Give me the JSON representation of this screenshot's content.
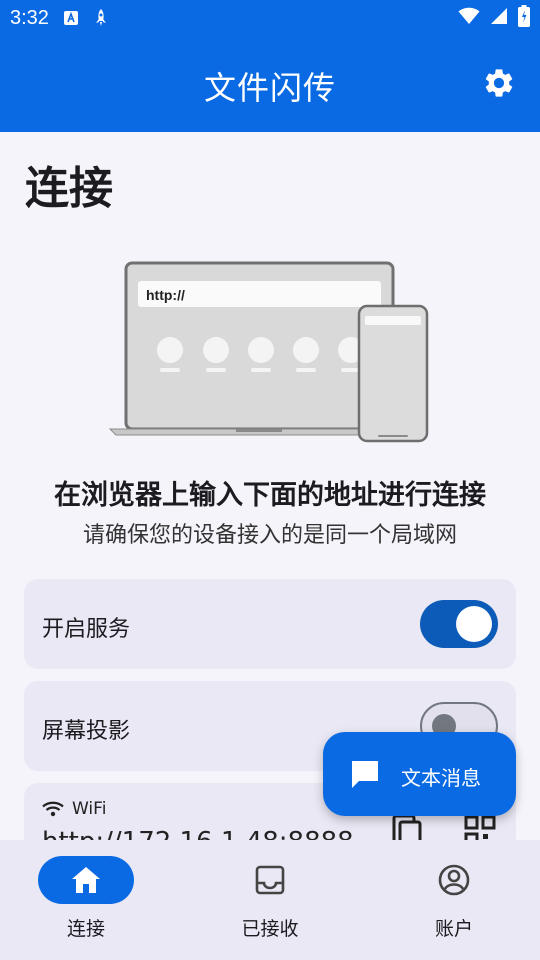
{
  "status_bar": {
    "time": "3:32",
    "icons": [
      "a-icon",
      "rocket-icon",
      "wifi-icon",
      "signal-icon",
      "battery-icon"
    ]
  },
  "app_bar": {
    "title": "文件闪传",
    "settings_icon": "gear-icon"
  },
  "main": {
    "title": "连接",
    "illustration": {
      "browser_text": "http://"
    },
    "headline": "在浏览器上输入下面的地址进行连接",
    "subline": "请确保您的设备接入的是同一个局域网",
    "service_toggle": {
      "label": "开启服务",
      "on": true
    },
    "projection_toggle": {
      "label": "屏幕投影",
      "on": false
    },
    "address_card": {
      "network_label": "WiFi",
      "url": "http://172.16.1.48:8888",
      "copy_icon": "copy-icon",
      "qr_icon": "qr-code-icon"
    }
  },
  "fab": {
    "label": "文本消息",
    "icon": "chat-icon"
  },
  "bottom_nav": {
    "items": [
      {
        "label": "连接",
        "icon": "home-icon",
        "active": true
      },
      {
        "label": "已接收",
        "icon": "inbox-icon",
        "active": false
      },
      {
        "label": "账户",
        "icon": "account-icon",
        "active": false
      }
    ]
  },
  "colors": {
    "primary": "#0a6ae3",
    "toggle_on": "#0d5bb8",
    "card_bg": "#e9e8f4",
    "page_bg": "#f5f4fb"
  }
}
